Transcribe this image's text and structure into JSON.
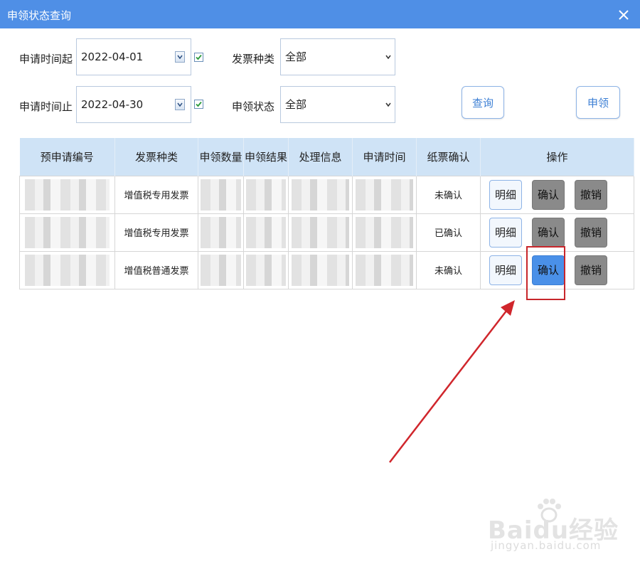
{
  "window": {
    "title": "申领状态查询",
    "close_label": "X"
  },
  "filters": {
    "start_label": "申请时间起",
    "start_value": "2022-04-01",
    "start_checked": true,
    "end_label": "申请时间止",
    "end_value": "2022-04-30",
    "end_checked": true,
    "invoice_type_label": "发票种类",
    "invoice_type_value": "全部",
    "status_label": "申领状态",
    "status_value": "全部"
  },
  "buttons": {
    "query": "查询",
    "apply": "申领"
  },
  "table": {
    "columns": [
      "预申请编号",
      "发票种类",
      "申领数量",
      "申领结果",
      "处理信息",
      "申请时间",
      "纸票确认",
      "操作"
    ],
    "rows": [
      {
        "invoice_type": "增值税专用发票",
        "paper_confirm": "未确认"
      },
      {
        "invoice_type": "增值税专用发票",
        "paper_confirm": "已确认"
      },
      {
        "invoice_type": "增值税普通发票",
        "paper_confirm": "未确认"
      }
    ],
    "actions": {
      "detail": "明细",
      "confirm": "确认",
      "cancel": "撤销"
    }
  },
  "watermark": {
    "main": "Baidu经验",
    "sub": "jingyan.baidu.com"
  },
  "colors": {
    "titlebar": "#4f8fe6",
    "highlight": "#c8262b",
    "active_button": "#4a90e8"
  }
}
